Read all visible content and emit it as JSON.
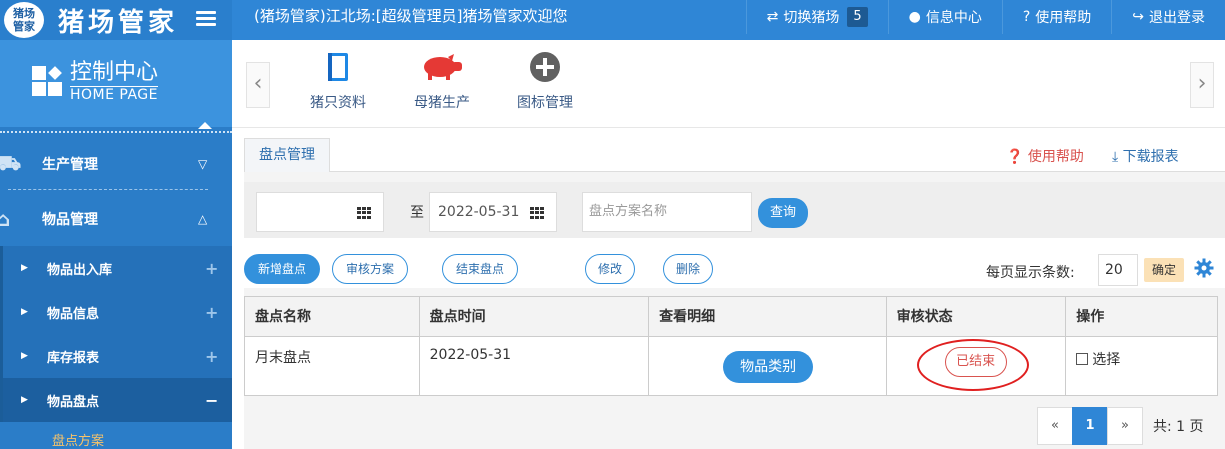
{
  "app": {
    "logo_badge_line1": "猪场",
    "logo_badge_line2": "管家",
    "title": "猪场管家",
    "welcome": "(猪场管家)江北场:[超级管理员]猪场管家欢迎您"
  },
  "topnav": {
    "switch_label": "切换猪场",
    "switch_count": "5",
    "info_center": "信息中心",
    "help": "使用帮助",
    "logout": "退出登录"
  },
  "sidebar": {
    "home_cn": "控制中心",
    "home_en": "HOME PAGE",
    "groups": [
      {
        "label": "生产管理"
      },
      {
        "label": "物品管理"
      }
    ],
    "sub_items": [
      {
        "label": "物品出入库"
      },
      {
        "label": "物品信息"
      },
      {
        "label": "库存报表"
      },
      {
        "label": "物品盘点"
      }
    ],
    "leaf": "盘点方案"
  },
  "shortcuts": [
    {
      "label": "猪只资料",
      "icon": "notebook-icon"
    },
    {
      "label": "母猪生产",
      "icon": "pig-icon"
    },
    {
      "label": "图标管理",
      "icon": "plus-circle-icon"
    }
  ],
  "main": {
    "tab": "盘点管理",
    "help_link": "使用帮助",
    "download_link": "下载报表",
    "filter": {
      "start_date": "",
      "to_label": "至",
      "end_date": "2022-05-31",
      "scheme_placeholder": "盘点方案名称",
      "query": "查询"
    },
    "toolbar": {
      "add": "新增盘点",
      "review": "审核方案",
      "finish": "结束盘点",
      "edit": "修改",
      "delete": "删除",
      "per_page_label": "每页显示条数:",
      "per_page_value": "20",
      "confirm": "确定"
    },
    "table": {
      "headers": [
        "盘点名称",
        "盘点时间",
        "查看明细",
        "审核状态",
        "操作"
      ],
      "rows": [
        {
          "name": "月末盘点",
          "time": "2022-05-31",
          "detail": "物品类别",
          "status": "已结束",
          "action": "选择"
        }
      ]
    },
    "pagination": {
      "prev": "«",
      "current": "1",
      "next": "»",
      "total": "共: 1 页"
    }
  },
  "colors": {
    "primary": "#2f86d6",
    "sidebar": "#2b7dc8",
    "danger": "#d9534f",
    "highlight": "#f7c36a"
  }
}
